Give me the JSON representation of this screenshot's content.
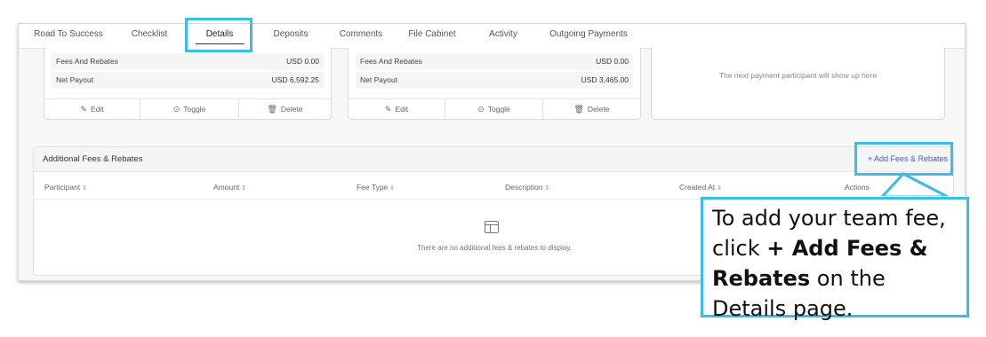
{
  "tabs": [
    "Road To Success",
    "Checklist",
    "Details",
    "Deposits",
    "Comments",
    "File Cabinet",
    "Activity",
    "Outgoing Payments"
  ],
  "active_tab": "Details",
  "cards": [
    {
      "rows": [
        {
          "label": "Fees And Rebates",
          "value": "USD 0.00"
        },
        {
          "label": "Net Payout",
          "value": "USD 6,592.25"
        }
      ],
      "actions": {
        "edit": "Edit",
        "toggle": "Toggle",
        "delete": "Delete"
      }
    },
    {
      "rows": [
        {
          "label": "Fees And Rebates",
          "value": "USD 0.00"
        },
        {
          "label": "Net Payout",
          "value": "USD 3,465.00"
        }
      ],
      "actions": {
        "edit": "Edit",
        "toggle": "Toggle",
        "delete": "Delete"
      }
    }
  ],
  "placeholder_text": "The next payment participant will show up here",
  "fees_section": {
    "title": "Additional Fees & Rebates",
    "add_button": "+ Add Fees & Rebates",
    "columns": [
      "Participant",
      "Amount",
      "Fee Type",
      "Description",
      "Created At",
      "Actions"
    ],
    "empty_text": "There are no additional fees & rebates to display."
  },
  "callout": {
    "part1": "To add your team fee, click ",
    "bold1": "+ Add Fees & Rebates",
    "part2": " on the Details page."
  },
  "colors": {
    "highlight": "#3cbde8",
    "link": "#3b5bd6"
  }
}
